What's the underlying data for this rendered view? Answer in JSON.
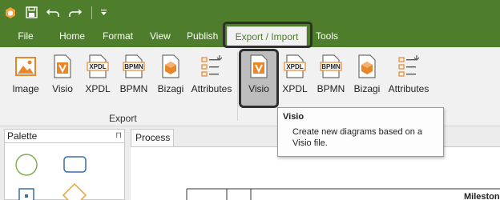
{
  "quick_access": {
    "icons": [
      "app-logo-icon",
      "save-icon",
      "undo-icon",
      "redo-icon",
      "customize-toolbar-icon"
    ]
  },
  "ribbon_tabs": {
    "file": "File",
    "home": "Home",
    "format": "Format",
    "view": "View",
    "publish": "Publish",
    "export_import": "Export / Import",
    "tools": "Tools"
  },
  "export_group": {
    "label": "Export",
    "buttons": [
      "Image",
      "Visio",
      "XPDL",
      "BPMN",
      "Bizagi",
      "Attributes"
    ]
  },
  "import_group": {
    "buttons": [
      "Visio",
      "XPDL",
      "BPMN",
      "Bizagi",
      "Attributes"
    ]
  },
  "tooltip": {
    "title": "Visio",
    "body": "Create new diagrams based on a Visio file."
  },
  "palette": {
    "title": "Palette",
    "pin": "⊓"
  },
  "document_tab": "Process",
  "canvas": {
    "partial_label": "Milestone"
  },
  "colors": {
    "accent_green": "#4e7d2c",
    "ribbon_bg": "#f1f1f1",
    "icon_orange": "#e8872a",
    "shape_blue": "#3a6ea5",
    "shape_green": "#7fb04f"
  }
}
